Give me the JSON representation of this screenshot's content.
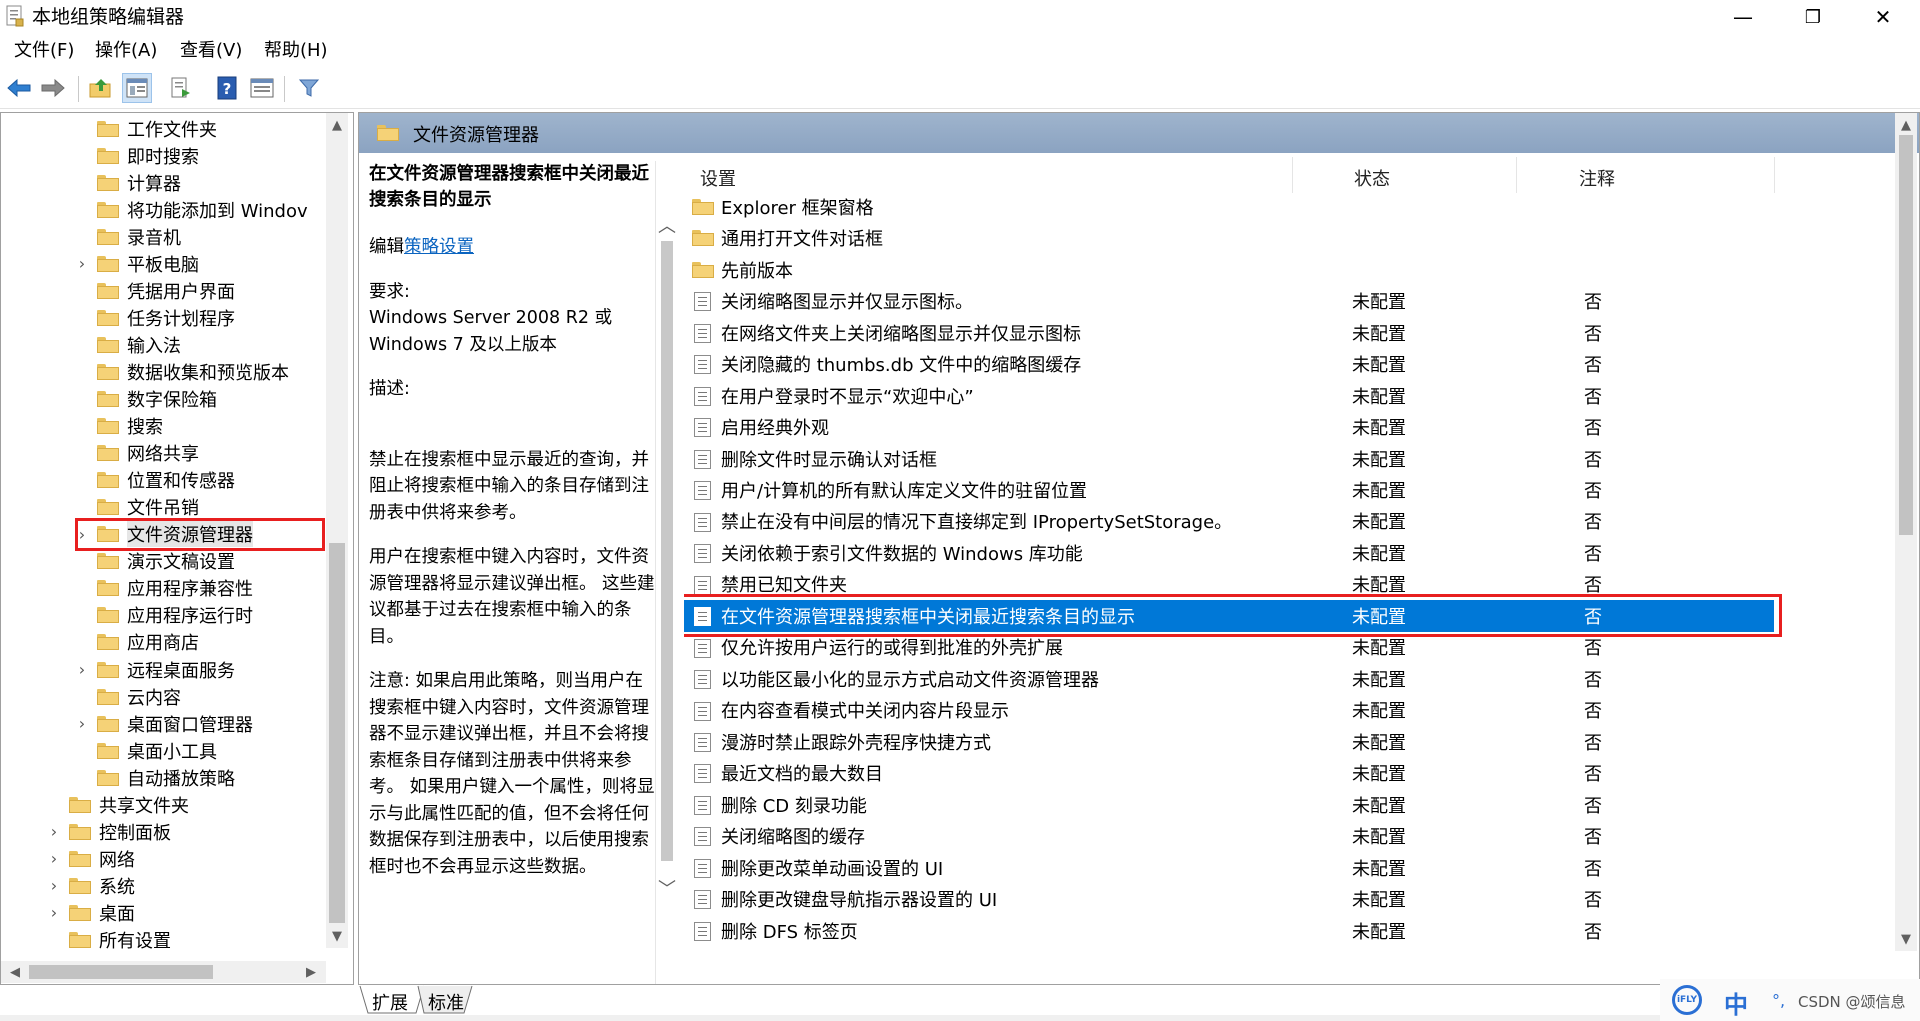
{
  "window": {
    "title": "本地组策略编辑器",
    "controls": {
      "minimize": "—",
      "restore": "❐",
      "close": "✕"
    }
  },
  "menu": [
    "文件(F)",
    "操作(A)",
    "查看(V)",
    "帮助(H)"
  ],
  "toolbar_icons": [
    "back-arrow-icon",
    "forward-arrow-icon",
    "up-folder-icon",
    "show-tree-icon",
    "export-list-icon",
    "help-icon",
    "properties-icon",
    "filter-icon"
  ],
  "tree": {
    "items": [
      {
        "label": "工作文件夹",
        "level": 2,
        "expander": ""
      },
      {
        "label": "即时搜索",
        "level": 2,
        "expander": ""
      },
      {
        "label": "计算器",
        "level": 2,
        "expander": ""
      },
      {
        "label": "将功能添加到 Windov",
        "level": 2,
        "expander": ""
      },
      {
        "label": "录音机",
        "level": 2,
        "expander": ""
      },
      {
        "label": "平板电脑",
        "level": 2,
        "expander": "›"
      },
      {
        "label": "凭据用户界面",
        "level": 2,
        "expander": ""
      },
      {
        "label": "任务计划程序",
        "level": 2,
        "expander": ""
      },
      {
        "label": "输入法",
        "level": 2,
        "expander": ""
      },
      {
        "label": "数据收集和预览版本",
        "level": 2,
        "expander": ""
      },
      {
        "label": "数字保险箱",
        "level": 2,
        "expander": ""
      },
      {
        "label": "搜索",
        "level": 2,
        "expander": ""
      },
      {
        "label": "网络共享",
        "level": 2,
        "expander": ""
      },
      {
        "label": "位置和传感器",
        "level": 2,
        "expander": ""
      },
      {
        "label": "文件吊销",
        "level": 2,
        "expander": ""
      },
      {
        "label": "文件资源管理器",
        "level": 2,
        "expander": "›",
        "selected": true
      },
      {
        "label": "演示文稿设置",
        "level": 2,
        "expander": ""
      },
      {
        "label": "应用程序兼容性",
        "level": 2,
        "expander": ""
      },
      {
        "label": "应用程序运行时",
        "level": 2,
        "expander": ""
      },
      {
        "label": "应用商店",
        "level": 2,
        "expander": ""
      },
      {
        "label": "远程桌面服务",
        "level": 2,
        "expander": "›"
      },
      {
        "label": "云内容",
        "level": 2,
        "expander": ""
      },
      {
        "label": "桌面窗口管理器",
        "level": 2,
        "expander": "›"
      },
      {
        "label": "桌面小工具",
        "level": 2,
        "expander": ""
      },
      {
        "label": "自动播放策略",
        "level": 2,
        "expander": ""
      },
      {
        "label": "共享文件夹",
        "level": 1,
        "expander": ""
      },
      {
        "label": "控制面板",
        "level": 1,
        "expander": "›"
      },
      {
        "label": "网络",
        "level": 1,
        "expander": "›"
      },
      {
        "label": "系统",
        "level": 1,
        "expander": "›"
      },
      {
        "label": "桌面",
        "level": 1,
        "expander": "›"
      },
      {
        "label": "所有设置",
        "level": 1,
        "expander": ""
      }
    ]
  },
  "right_header": "文件资源管理器",
  "description": {
    "title": "在文件资源管理器搜索框中关闭最近搜索条目的显示",
    "edit_prefix": "编辑",
    "edit_link": "策略设置",
    "requirements_label": "要求:",
    "requirements_text": "Windows Server 2008 R2 或 Windows 7 及以上版本",
    "description_label": "描述:",
    "para1": "禁止在搜索框中显示最近的查询，并阻止将搜索框中输入的条目存储到注册表中供将来参考。",
    "para2": "用户在搜索框中键入内容时，文件资源管理器将显示建议弹出框。 这些建议都基于过去在搜索框中输入的条目。",
    "para3": "注意: 如果启用此策略，则当用户在搜索框中键入内容时，文件资源管理器不显示建议弹出框，并且不会将搜索框条目存储到注册表中供将来参考。 如果用户键入一个属性，则将显示与此属性匹配的值，但不会将任何数据保存到注册表中，以后使用搜索框时也不会再显示这些数据。"
  },
  "list": {
    "columns": [
      "设置",
      "状态",
      "注释"
    ],
    "folders": [
      "Explorer 框架窗格",
      "通用打开文件对话框",
      "先前版本"
    ],
    "rows": [
      {
        "name": "关闭缩略图显示并仅显示图标。",
        "state": "未配置",
        "note": "否"
      },
      {
        "name": "在网络文件夹上关闭缩略图显示并仅显示图标",
        "state": "未配置",
        "note": "否"
      },
      {
        "name": "关闭隐藏的 thumbs.db 文件中的缩略图缓存",
        "state": "未配置",
        "note": "否"
      },
      {
        "name": "在用户登录时不显示“欢迎中心”",
        "state": "未配置",
        "note": "否"
      },
      {
        "name": "启用经典外观",
        "state": "未配置",
        "note": "否"
      },
      {
        "name": "删除文件时显示确认对话框",
        "state": "未配置",
        "note": "否"
      },
      {
        "name": "用户/计算机的所有默认库定义文件的驻留位置",
        "state": "未配置",
        "note": "否"
      },
      {
        "name": "禁止在没有中间层的情况下直接绑定到 IPropertySetStorage。",
        "state": "未配置",
        "note": "否"
      },
      {
        "name": "关闭依赖于索引文件数据的 Windows 库功能",
        "state": "未配置",
        "note": "否"
      },
      {
        "name": "禁用已知文件夹",
        "state": "未配置",
        "note": "否"
      },
      {
        "name": "在文件资源管理器搜索框中关闭最近搜索条目的显示",
        "state": "未配置",
        "note": "否",
        "selected": true
      },
      {
        "name": "仅允许按用户运行的或得到批准的外壳扩展",
        "state": "未配置",
        "note": "否"
      },
      {
        "name": "以功能区最小化的显示方式启动文件资源管理器",
        "state": "未配置",
        "note": "否"
      },
      {
        "name": "在内容查看模式中关闭内容片段显示",
        "state": "未配置",
        "note": "否"
      },
      {
        "name": "漫游时禁止跟踪外壳程序快捷方式",
        "state": "未配置",
        "note": "否"
      },
      {
        "name": "最近文档的最大数目",
        "state": "未配置",
        "note": "否"
      },
      {
        "name": "删除 CD 刻录功能",
        "state": "未配置",
        "note": "否"
      },
      {
        "name": "关闭缩略图的缓存",
        "state": "未配置",
        "note": "否"
      },
      {
        "name": "删除更改菜单动画设置的 UI",
        "state": "未配置",
        "note": "否"
      },
      {
        "name": "删除更改键盘导航指示器设置的 UI",
        "state": "未配置",
        "note": "否"
      },
      {
        "name": "删除 DFS 标签页",
        "state": "未配置",
        "note": "否"
      }
    ]
  },
  "tabs": [
    "扩展",
    "标准"
  ],
  "tray": {
    "ime": "中",
    "watermark": "CSDN @颂信息"
  },
  "colors": {
    "selection": "#0078d7",
    "highlight_box": "#e81f1f",
    "header_band": "#93aac6",
    "folder": "#f5d277"
  }
}
